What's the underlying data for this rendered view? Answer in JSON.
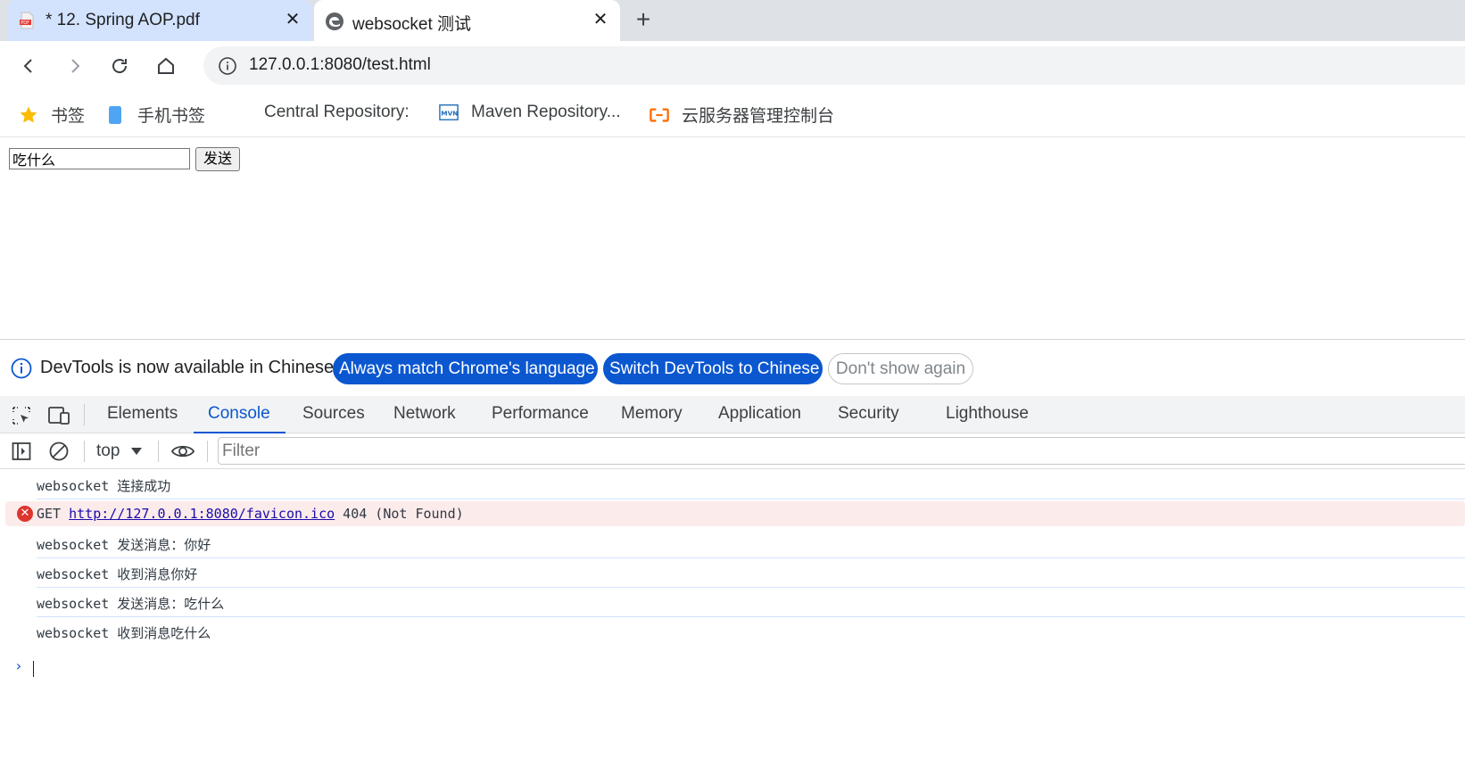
{
  "tabs": [
    {
      "title": "* 12. Spring AOP.pdf",
      "icon": "pdf-icon",
      "active": false
    },
    {
      "title": "websocket 测试",
      "icon": "edge-icon",
      "active": true
    }
  ],
  "toolbar": {
    "url": "127.0.0.1:8080/test.html"
  },
  "bookmarks": [
    {
      "label": "书签",
      "icon": "star-icon"
    },
    {
      "label": "手机书签",
      "icon": "phone-icon"
    },
    {
      "label": "Central Repository:",
      "icon": ""
    },
    {
      "label": "Maven Repository...",
      "icon": "mvn-icon"
    },
    {
      "label": "云服务器管理控制台",
      "icon": "aliyun-icon"
    }
  ],
  "page": {
    "input_value": "吃什么",
    "send_label": "发送"
  },
  "devtools": {
    "infobar": {
      "text": "DevTools is now available in Chinese!",
      "match_language": "Always match Chrome's language",
      "switch_chinese": "Switch DevTools to Chinese",
      "dont_show": "Don't show again"
    },
    "tabs": [
      "Elements",
      "Console",
      "Sources",
      "Network",
      "Performance",
      "Memory",
      "Application",
      "Security",
      "Lighthouse"
    ],
    "active_tab": "Console",
    "console": {
      "context": "top",
      "filter_placeholder": "Filter",
      "messages": [
        {
          "type": "log",
          "text": "websocket 连接成功"
        },
        {
          "type": "error",
          "prefix": "GET ",
          "link": "http://127.0.0.1:8080/favicon.ico",
          "suffix": " 404 (Not Found)"
        },
        {
          "type": "log",
          "text": "websocket 发送消息：你好"
        },
        {
          "type": "log",
          "text": "websocket 收到消息你好"
        },
        {
          "type": "log",
          "text": "websocket 发送消息：吃什么"
        },
        {
          "type": "log",
          "text": "websocket 收到消息吃什么"
        }
      ]
    }
  },
  "colors": {
    "accent": "#0b57d0",
    "tab_strip": "#dee1e6",
    "error_bg": "#fcebeb",
    "error_icon": "#dc362e"
  }
}
